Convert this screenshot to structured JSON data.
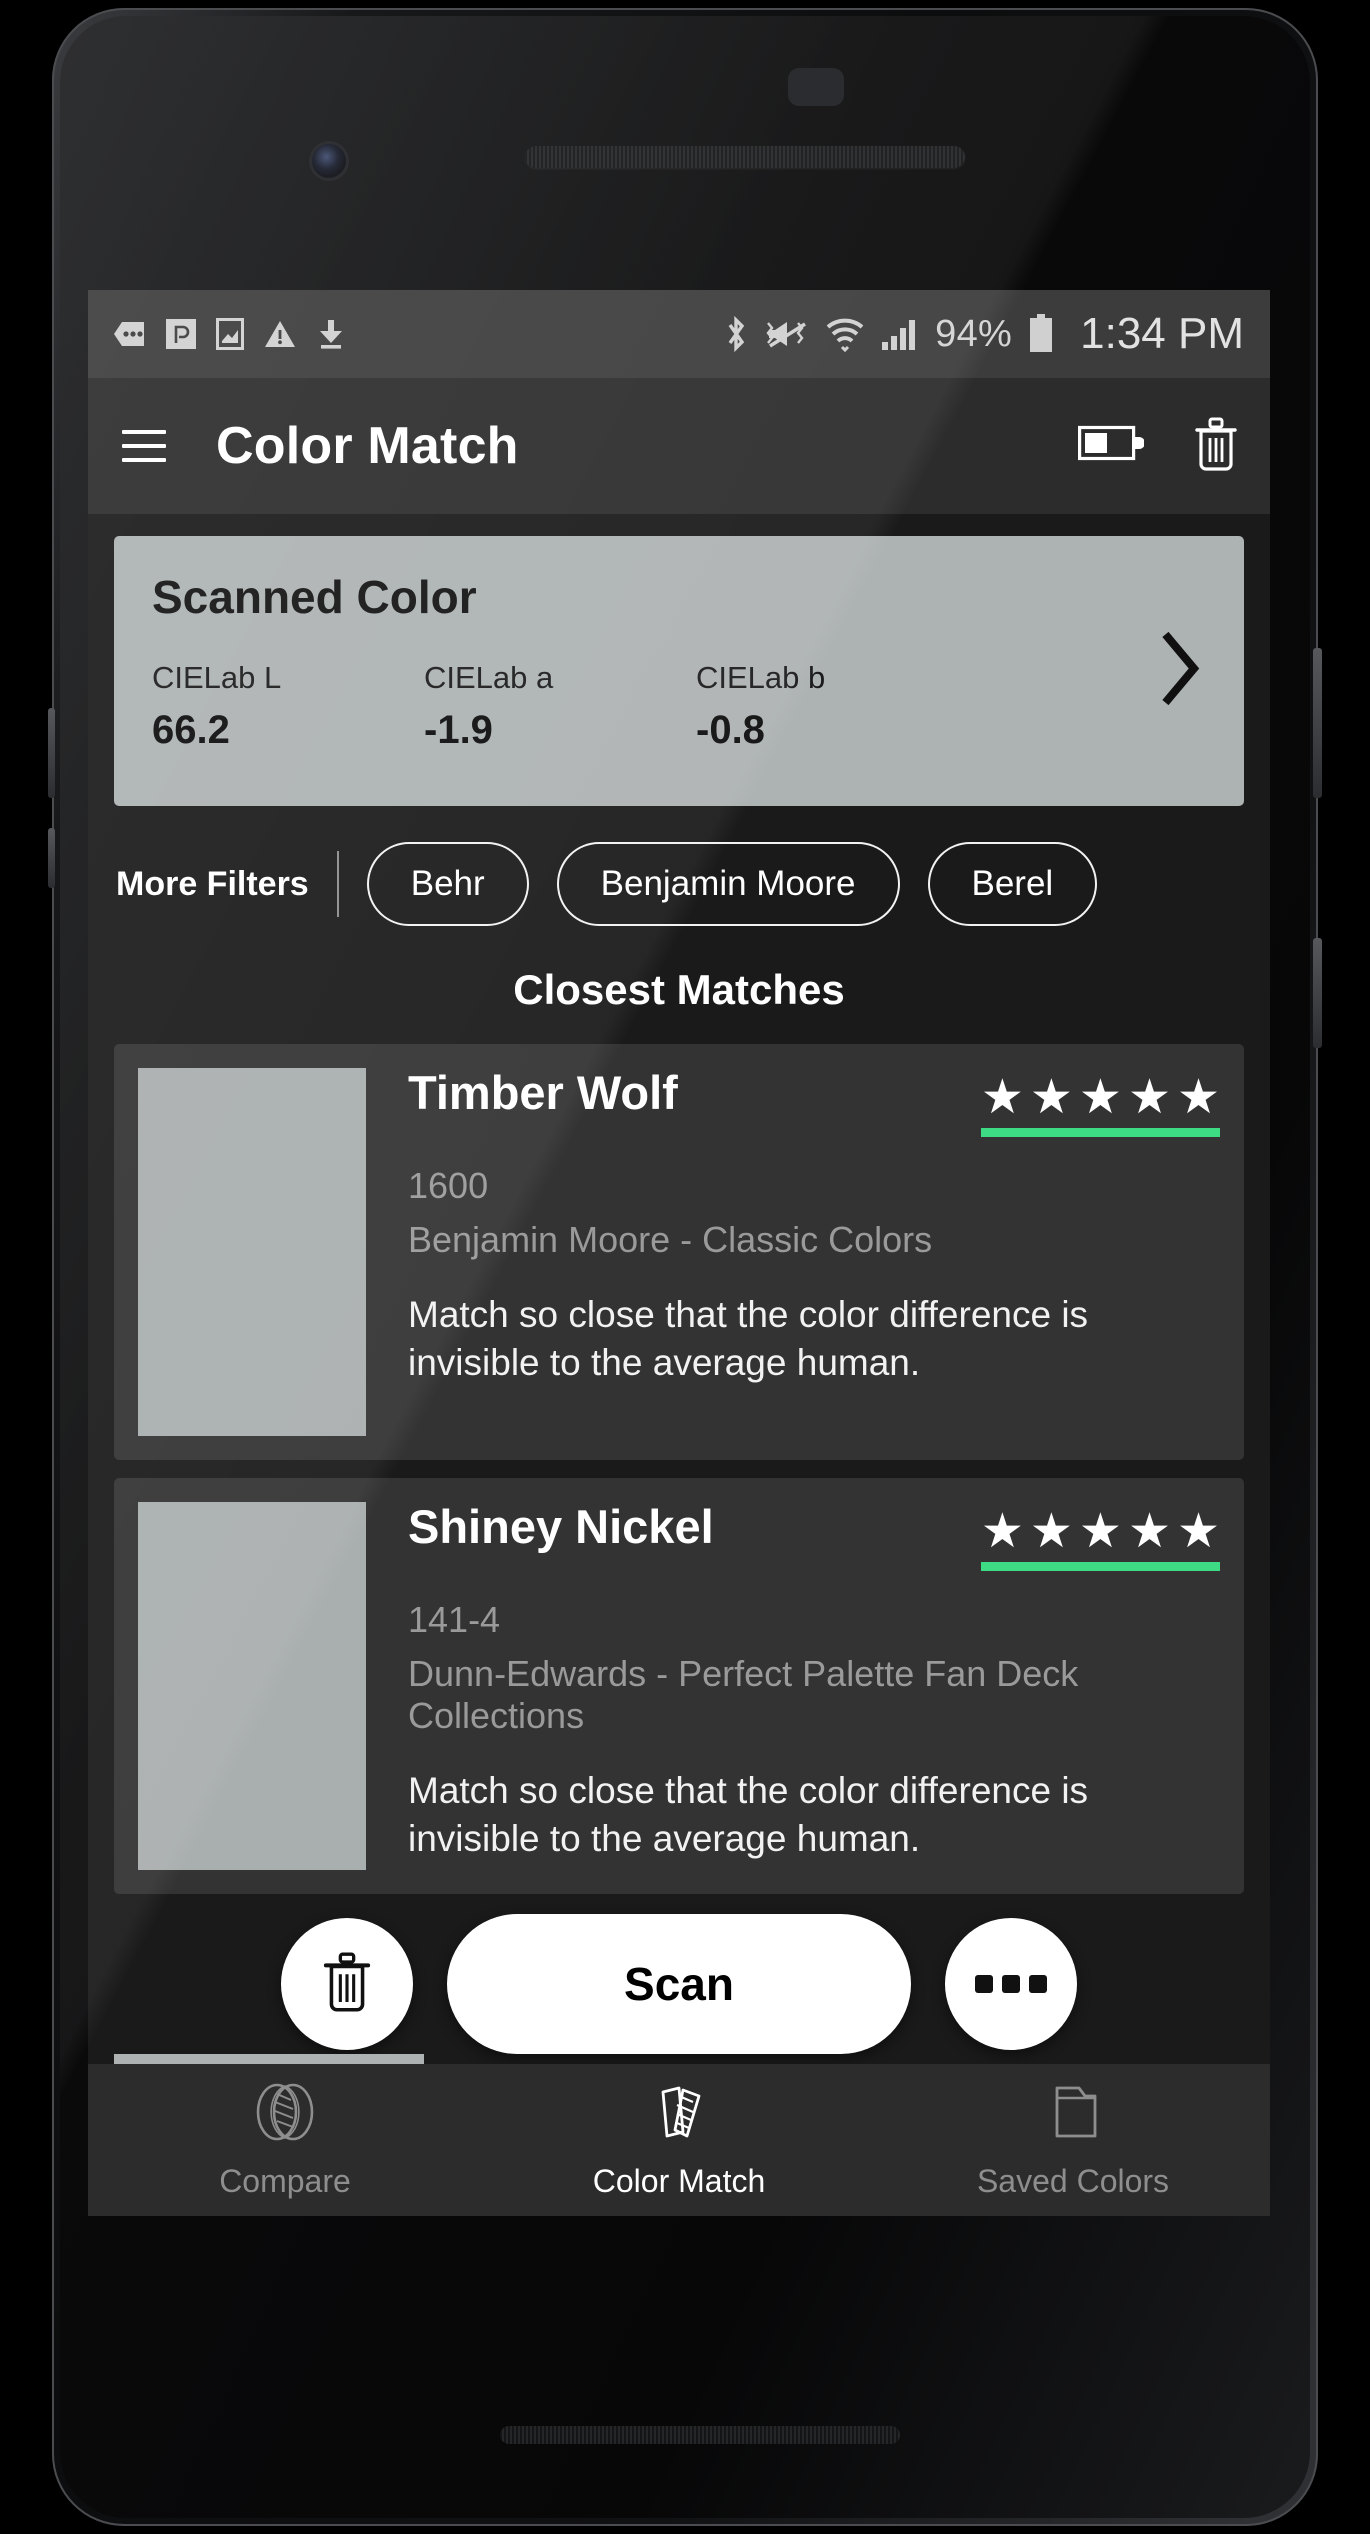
{
  "statusbar": {
    "icons_left": [
      "more-horizontal-badge-icon",
      "p-app-icon",
      "image-icon",
      "warning-icon",
      "download-icon"
    ],
    "icons_right": [
      "bluetooth-icon",
      "vibrate-off-icon",
      "wifi-icon",
      "cellular-signal-icon"
    ],
    "battery_percent": "94%",
    "time": "1:34 PM"
  },
  "appbar": {
    "menu_icon": "hamburger-menu-icon",
    "title": "Color Match",
    "battery_icon": "battery-half-icon",
    "delete_icon": "trash-icon"
  },
  "scanned_color": {
    "title": "Scanned Color",
    "swatch_hex": "#adb2b2",
    "chevron_icon": "chevron-right-icon",
    "metrics": [
      {
        "label": "CIELab L",
        "value": "66.2"
      },
      {
        "label": "CIELab a",
        "value": "-1.9"
      },
      {
        "label": "CIELab b",
        "value": "-0.8"
      }
    ]
  },
  "filters": {
    "more_filters_label": "More Filters",
    "chips": [
      "Behr",
      "Benjamin Moore",
      "Berel"
    ]
  },
  "matches": {
    "heading": "Closest Matches",
    "accent_hex": "#3ddc84",
    "items": [
      {
        "name": "Timber Wolf",
        "code": "1600",
        "brand": "Benjamin Moore - Classic Colors",
        "description": "Match so close that the color difference is invisible to the average human.",
        "stars": 5,
        "swatch_hex": "#a9aeae"
      },
      {
        "name": "Shiney Nickel",
        "code": "141-4",
        "brand": "Dunn-Edwards - Perfect Palette Fan Deck Collections",
        "description": "Match so close that the color difference is invisible to the average human.",
        "stars": 5,
        "swatch_hex": "#a9aeae"
      }
    ]
  },
  "fabs": {
    "delete_icon": "trash-icon",
    "scan_label": "Scan",
    "overflow_icon": "more-horizontal-icon"
  },
  "bottomnav": {
    "items": [
      {
        "label": "Compare",
        "icon": "venn-compare-icon",
        "active": false
      },
      {
        "label": "Color Match",
        "icon": "color-swatch-fan-icon",
        "active": true
      },
      {
        "label": "Saved Colors",
        "icon": "folder-icon",
        "active": false
      }
    ]
  }
}
